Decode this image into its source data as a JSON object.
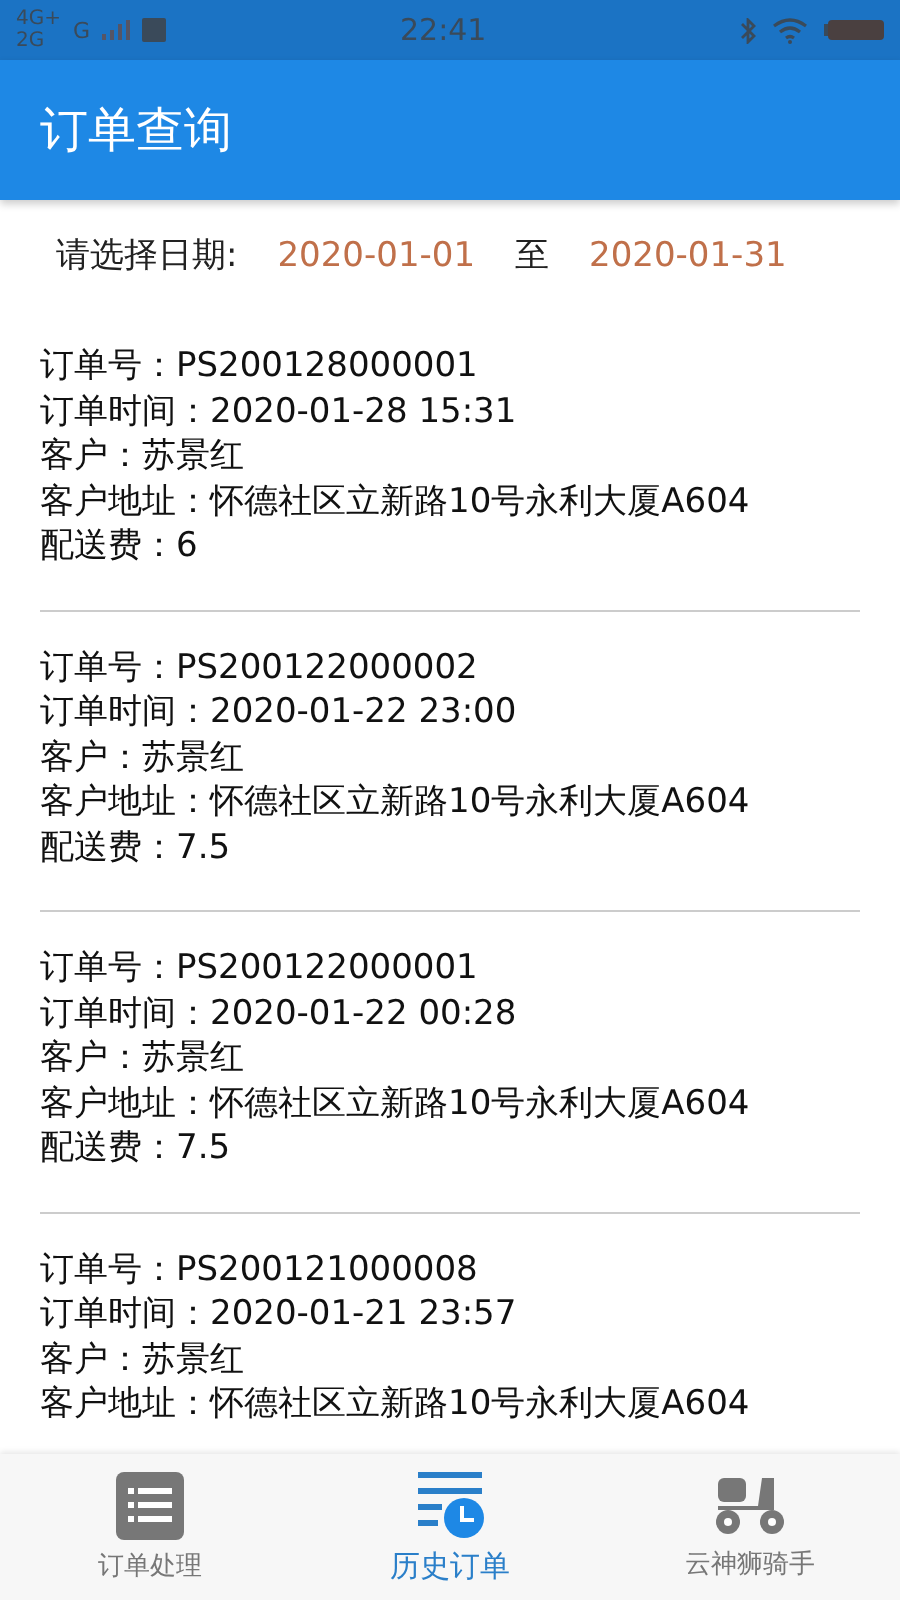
{
  "status_bar": {
    "network_top": "4G+",
    "network_bottom": "2G",
    "network_second": "G",
    "time": "22:41"
  },
  "header": {
    "title": "订单查询"
  },
  "date_filter": {
    "label": "请选择日期:",
    "start": "2020-01-01",
    "separator": "至",
    "end": "2020-01-31"
  },
  "orders": [
    {
      "lines": [
        "订单号：PS200128000001",
        "订单时间：2020-01-28 15:31",
        "客户：苏景红",
        "客户地址：怀德社区立新路10号永利大厦A604",
        "配送费：6"
      ]
    },
    {
      "lines": [
        "订单号：PS200122000002",
        "订单时间：2020-01-22 23:00",
        "客户：苏景红",
        "客户地址：怀德社区立新路10号永利大厦A604",
        "配送费：7.5"
      ]
    },
    {
      "lines": [
        "订单号：PS200122000001",
        "订单时间：2020-01-22 00:28",
        "客户：苏景红",
        "客户地址：怀德社区立新路10号永利大厦A604",
        "配送费：7.5"
      ]
    },
    {
      "lines": [
        "订单号：PS200121000008",
        "订单时间：2020-01-21 23:57",
        "客户：苏景红",
        "客户地址：怀德社区立新路10号永利大厦A604"
      ]
    }
  ],
  "bottom_nav": [
    {
      "label": "订单处理",
      "kind": "list",
      "selected": false
    },
    {
      "label": "历史订单",
      "kind": "history",
      "selected": true
    },
    {
      "label": "云神狮骑手",
      "kind": "scooter",
      "selected": false
    }
  ]
}
